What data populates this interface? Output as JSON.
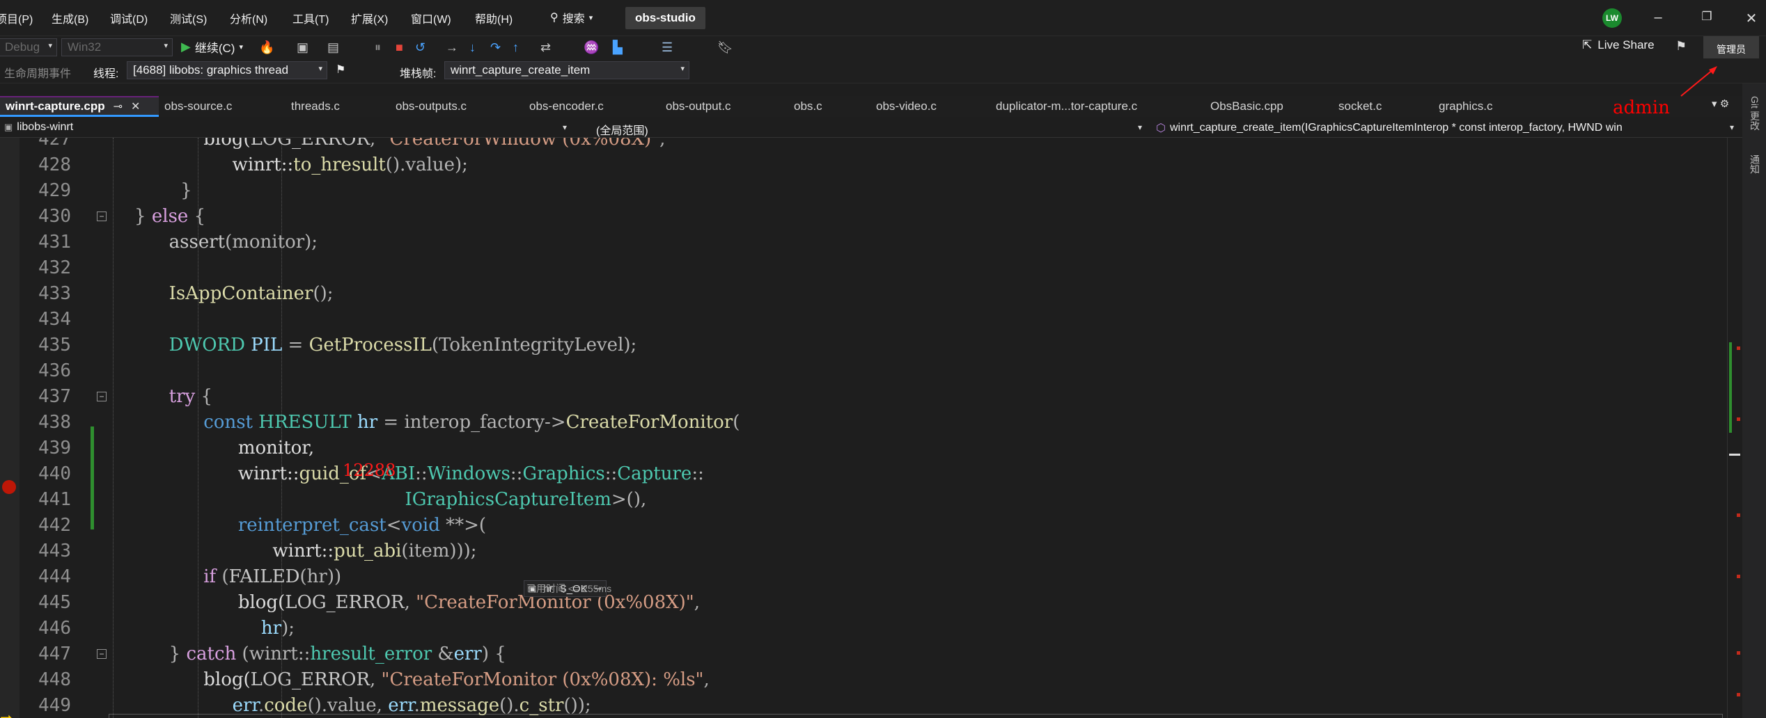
{
  "menu": {
    "items": [
      "项目(P)",
      "生成(B)",
      "调试(D)",
      "测试(S)",
      "分析(N)",
      "工具(T)",
      "扩展(X)",
      "窗口(W)",
      "帮助(H)"
    ],
    "search": "搜索",
    "project": "obs-studio"
  },
  "user": {
    "initials": "LW"
  },
  "toolbar": {
    "config": "Debug",
    "platform": "Win32",
    "continue_label": "继续(C)",
    "live_share": "Live Share",
    "admin_button": "管理员"
  },
  "debug_bar": {
    "lifecycle": "生命周期事件",
    "thread_label": "线程:",
    "thread_value": "[4688] libobs: graphics thread",
    "stack_label": "堆栈帧:",
    "stack_value": "winrt_capture_create_item"
  },
  "tabs": [
    "winrt-capture.cpp",
    "obs-source.c",
    "threads.c",
    "obs-outputs.c",
    "obs-encoder.c",
    "obs-output.c",
    "obs.c",
    "obs-video.c",
    "duplicator-m...tor-capture.c",
    "ObsBasic.cpp",
    "socket.c",
    "graphics.c"
  ],
  "annotation_admin": "admin",
  "nav": {
    "project": "libobs-winrt",
    "scope": "(全局范围)",
    "member": "winrt_capture_create_item(IGraphicsCaptureItemInterop * const interop_factory, HWND win"
  },
  "code": {
    "line_numbers": [
      "427",
      "428",
      "429",
      "430",
      "431",
      "432",
      "433",
      "434",
      "435",
      "436",
      "437",
      "438",
      "439",
      "440",
      "441",
      "442",
      "443",
      "444",
      "445",
      "446",
      "447",
      "448",
      "449"
    ],
    "annotation_value": "12288",
    "datatip_name": "hr",
    "datatip_value": "S_OK",
    "elapsed": "已用时间 <= 255ms"
  },
  "right_rail": {
    "git": "Git 更改",
    "notify": "通知"
  }
}
